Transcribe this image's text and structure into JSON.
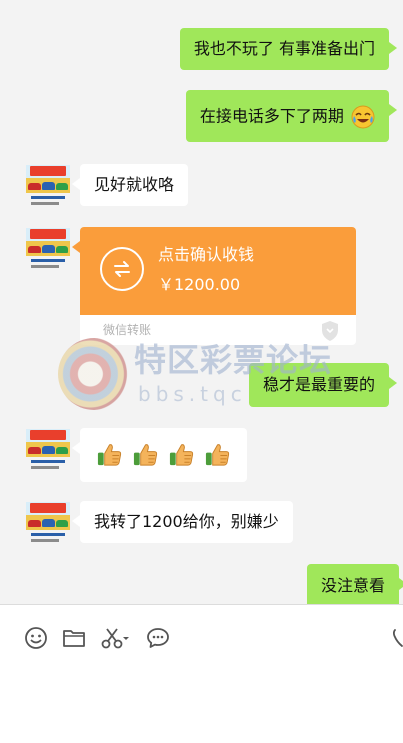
{
  "messages": [
    {
      "text": "我也不玩了 有事准备出门"
    },
    {
      "text": "在接电话多下了两期"
    },
    {
      "text": "见好就收咯"
    },
    {
      "text": "稳才是最重要的"
    },
    {
      "text": "我转了1200给你，别嫌少"
    },
    {
      "text": "没注意看"
    }
  ],
  "transfer": {
    "title": "点击确认收钱",
    "amount": "￥1200.00",
    "footer": "微信转账"
  },
  "watermark": {
    "name": "特区彩票论坛",
    "url": "bbs.tqc"
  },
  "thumbs_count": 4,
  "toolbar": {
    "icons": [
      "emoji-icon",
      "folder-icon",
      "scissors-icon",
      "chat-bubble-icon",
      "phone-icon"
    ]
  },
  "colors": {
    "chat_background": "#f3f3f3",
    "my_bubble": "#a0e75a",
    "their_bubble": "#ffffff",
    "transfer_orange": "#fa9d3b",
    "toolbar_background": "#ffffff"
  }
}
